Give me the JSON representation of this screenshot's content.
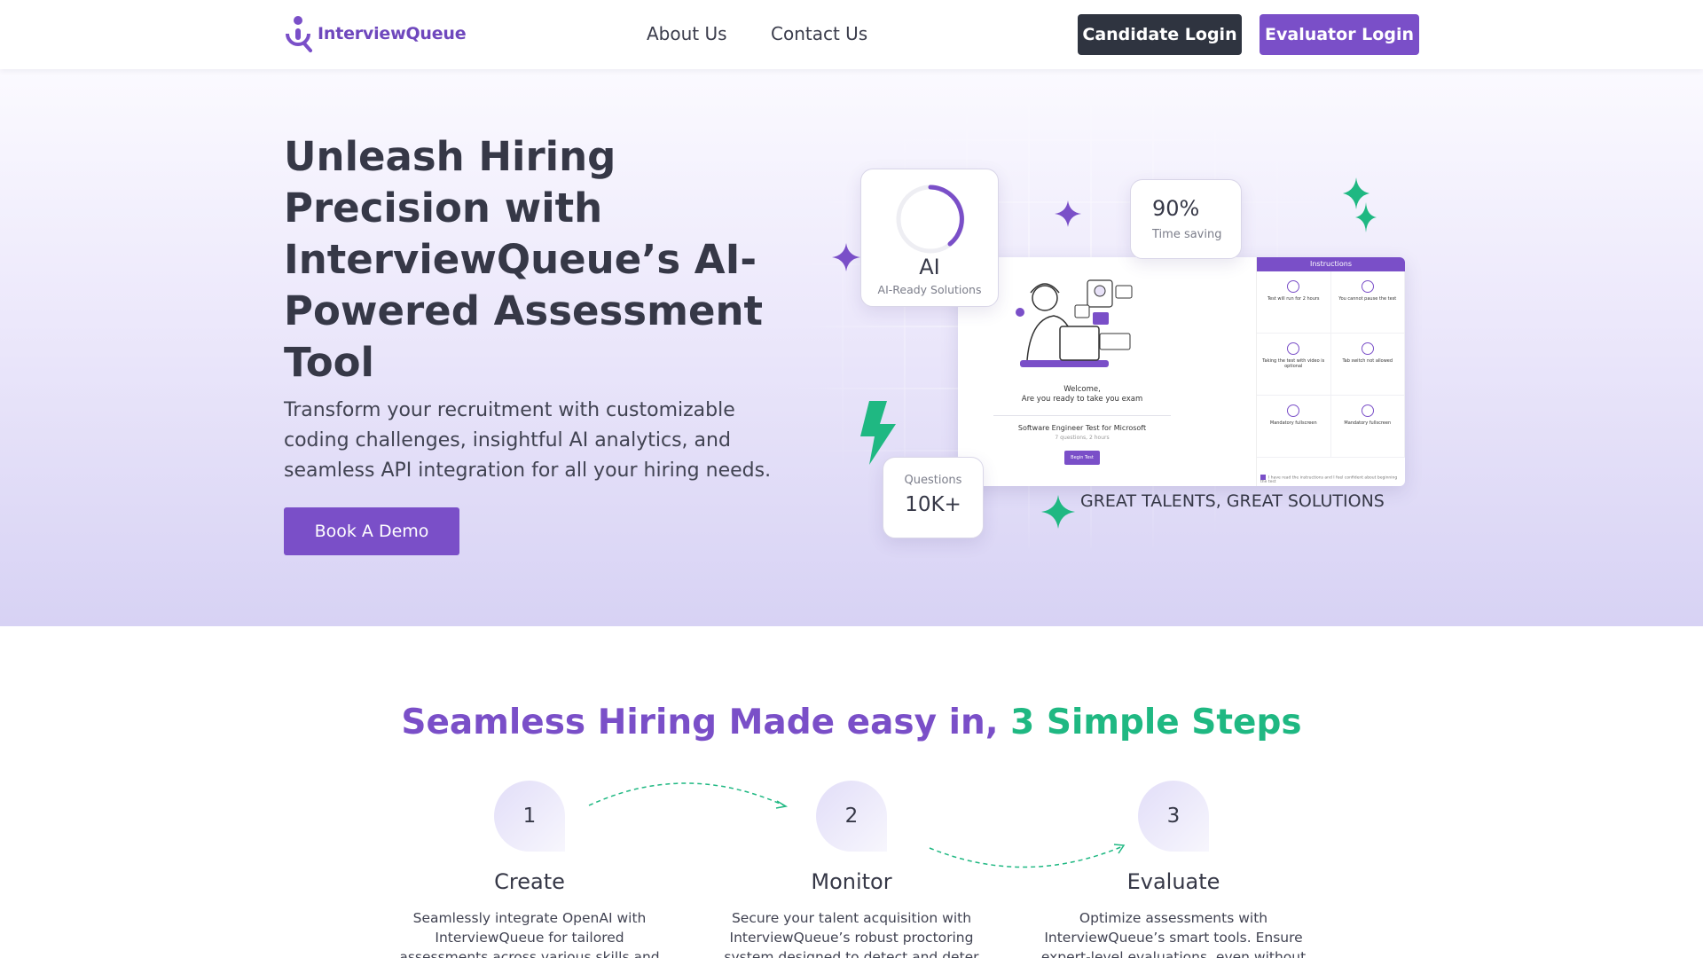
{
  "nav": {
    "brand": "InterviewQueue",
    "links": [
      "About Us",
      "Contact Us"
    ],
    "candidate_login": "Candidate Login",
    "evaluator_login": "Evaluator Login"
  },
  "hero": {
    "title": "Unleash Hiring Precision with InterviewQueue’s AI-Powered Assessment Tool",
    "subtitle": "Transform your recruitment with customizable coding challenges, insightful AI analytics, and seamless API integration for all your hiring needs.",
    "cta": "Book A Demo",
    "tagline": "GREAT TALENTS, GREAT SOLUTIONS",
    "stats": {
      "ai_value": "AI",
      "ai_label": "AI-Ready Solutions",
      "time_value": "90%",
      "time_label": "Time saving",
      "questions_label": "Questions",
      "questions_value": "10K+"
    },
    "preview": {
      "welcome_line1": "Welcome,",
      "welcome_line2": "Are you ready to take you exam",
      "test_name": "Software Engineer Test for Microsoft",
      "test_meta": "7 questions, 2 hours",
      "begin": "Begin Test",
      "instructions_title": "Instructions",
      "instructions": [
        "Test will run for 2 hours",
        "You cannot pause the test",
        "Taking the test with video is optional",
        "Tab switch not allowed",
        "Mandatory fullscreen",
        "Mandatory fullscreen"
      ],
      "agree": "I have read the instructions and I feel confident about beginning the test"
    }
  },
  "steps": {
    "title_part1": "Seamless Hiring Made easy in, ",
    "title_part2": "3 Simple Steps",
    "items": [
      {
        "num": "1",
        "name": "Create",
        "desc": "Seamlessly integrate OpenAI with InterviewQueue for tailored assessments across various skills and roles, optimizing"
      },
      {
        "num": "2",
        "name": "Monitor",
        "desc": "Secure your talent acquisition with InterviewQueue’s robust proctoring system designed to detect and deter any"
      },
      {
        "num": "3",
        "name": "Evaluate",
        "desc": "Optimize assessments with InterviewQueue’s smart tools. Ensure expert-level evaluations, even without in-"
      }
    ]
  },
  "colors": {
    "brand_purple": "#7a4fc8",
    "accent_green": "#1fb882",
    "dark_button": "#2f3440"
  },
  "icons": [
    "logo-person-icon",
    "sparkle-icon",
    "lightning-icon",
    "progress-ring-icon",
    "illustration-woman-laptop"
  ]
}
